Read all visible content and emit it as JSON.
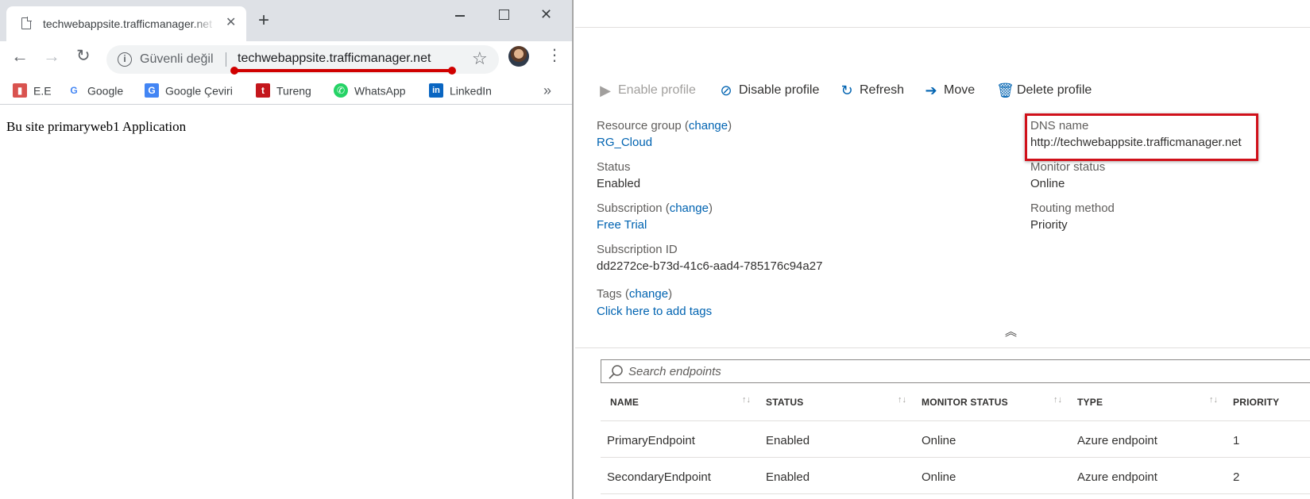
{
  "browser": {
    "tab_title": "techwebappsite.trafficmanager.net",
    "close_glyph": "✕",
    "new_tab_glyph": "+",
    "security_label": "Güvenli değil",
    "url": "techwebappsite.trafficmanager.net",
    "bookmarks": [
      {
        "label": "E.E",
        "icon": "book-icon",
        "color": "#d9534f"
      },
      {
        "label": "Google",
        "icon": "google-icon",
        "color": "#4285f4"
      },
      {
        "label": "Google Çeviri",
        "icon": "translate-icon",
        "color": "#4285f4"
      },
      {
        "label": "Tureng",
        "icon": "tureng-icon",
        "color": "#c4161c"
      },
      {
        "label": "WhatsApp",
        "icon": "whatsapp-icon",
        "color": "#25d366"
      },
      {
        "label": "LinkedIn",
        "icon": "linkedin-icon",
        "color": "#0a66c2"
      }
    ],
    "page_text": "Bu site primaryweb1 Application"
  },
  "azure": {
    "commands": [
      {
        "label": "Enable profile",
        "icon": "play-icon",
        "disabled": true
      },
      {
        "label": "Disable profile",
        "icon": "disable-icon",
        "disabled": false
      },
      {
        "label": "Refresh",
        "icon": "refresh-icon",
        "disabled": false
      },
      {
        "label": "Move",
        "icon": "arrow-right-icon",
        "disabled": false
      },
      {
        "label": "Delete profile",
        "icon": "trash-icon",
        "disabled": false
      }
    ],
    "essentials": {
      "resource_group_label": "Resource group",
      "change_link": "change",
      "resource_group_value": "RG_Cloud",
      "status_label": "Status",
      "status_value": "Enabled",
      "subscription_label": "Subscription",
      "subscription_value": "Free Trial",
      "subscription_id_label": "Subscription ID",
      "subscription_id_value": "dd2272ce-b73d-41c6-aad4-785176c94a27",
      "tags_label": "Tags",
      "tags_value": "Click here to add tags",
      "dns_label": "DNS name",
      "dns_value": "http://techwebappsite.trafficmanager.net",
      "monitor_label": "Monitor status",
      "monitor_value": "Online",
      "routing_label": "Routing method",
      "routing_value": "Priority"
    },
    "search_placeholder": "Search endpoints",
    "table": {
      "headers": [
        "NAME",
        "STATUS",
        "MONITOR STATUS",
        "TYPE",
        "PRIORITY"
      ],
      "rows": [
        [
          "PrimaryEndpoint",
          "Enabled",
          "Online",
          "Azure endpoint",
          "1"
        ],
        [
          "SecondaryEndpoint",
          "Enabled",
          "Online",
          "Azure endpoint",
          "2"
        ]
      ]
    },
    "accent_color": "#0063b1"
  }
}
